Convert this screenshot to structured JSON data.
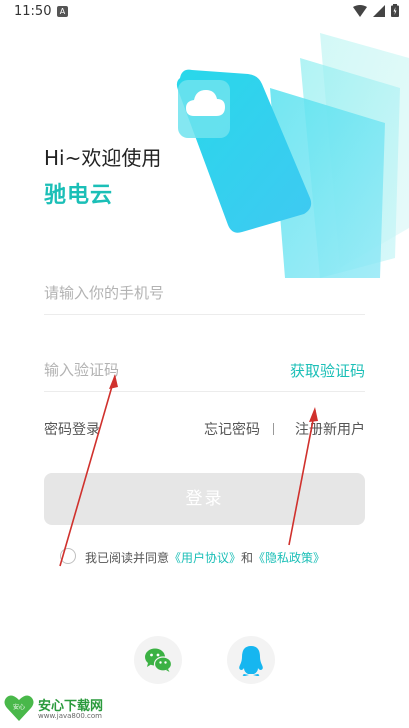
{
  "status_bar": {
    "time": "11:50",
    "notification_badge": "A"
  },
  "header": {
    "greeting": "Hi~欢迎使用",
    "brand": "驰电云"
  },
  "form": {
    "phone_placeholder": "请输入你的手机号",
    "code_placeholder": "输入验证码",
    "get_code_label": "获取验证码"
  },
  "links": {
    "password_login": "密码登录",
    "forgot_password": "忘记密码",
    "register": "注册新用户"
  },
  "login_button": "登录",
  "agreement": {
    "prefix": "我已阅读并同意",
    "user_agreement": "《用户协议》",
    "and": "和",
    "privacy_policy": "《隐私政策》"
  },
  "social_login": [
    {
      "icon": "wechat-icon"
    },
    {
      "icon": "qq-icon"
    }
  ],
  "watermark": {
    "title": "安心下载网",
    "url": "www.java800.com",
    "logo_text": "安心"
  },
  "colors": {
    "accent": "#1bbfb7",
    "button_disabled": "#e6e6e6",
    "wechat": "#3bb143",
    "qq": "#16b6f0",
    "annotation": "#d0312d"
  }
}
